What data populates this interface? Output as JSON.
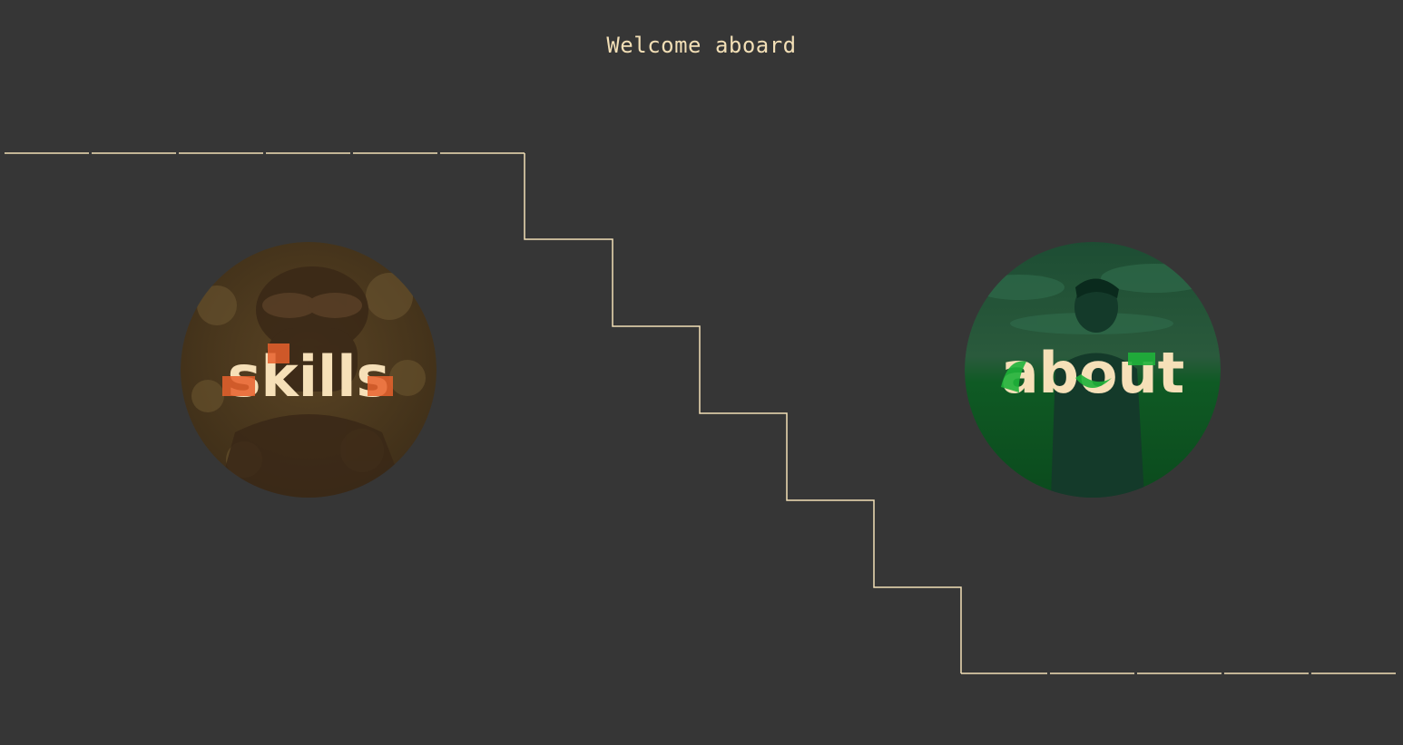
{
  "header": {
    "welcome_text": "Welcome aboard"
  },
  "links": {
    "skills": {
      "label": "skills",
      "icon": "soldier-photo-icon"
    },
    "about": {
      "label": "about",
      "icon": "man-in-field-photo-icon"
    }
  },
  "colors": {
    "background": "#363636",
    "text": "#f2dfb6",
    "stairs_line": "#f2dfb6",
    "skills_accent": "#e8612d",
    "about_accent": "#1fb23a"
  }
}
